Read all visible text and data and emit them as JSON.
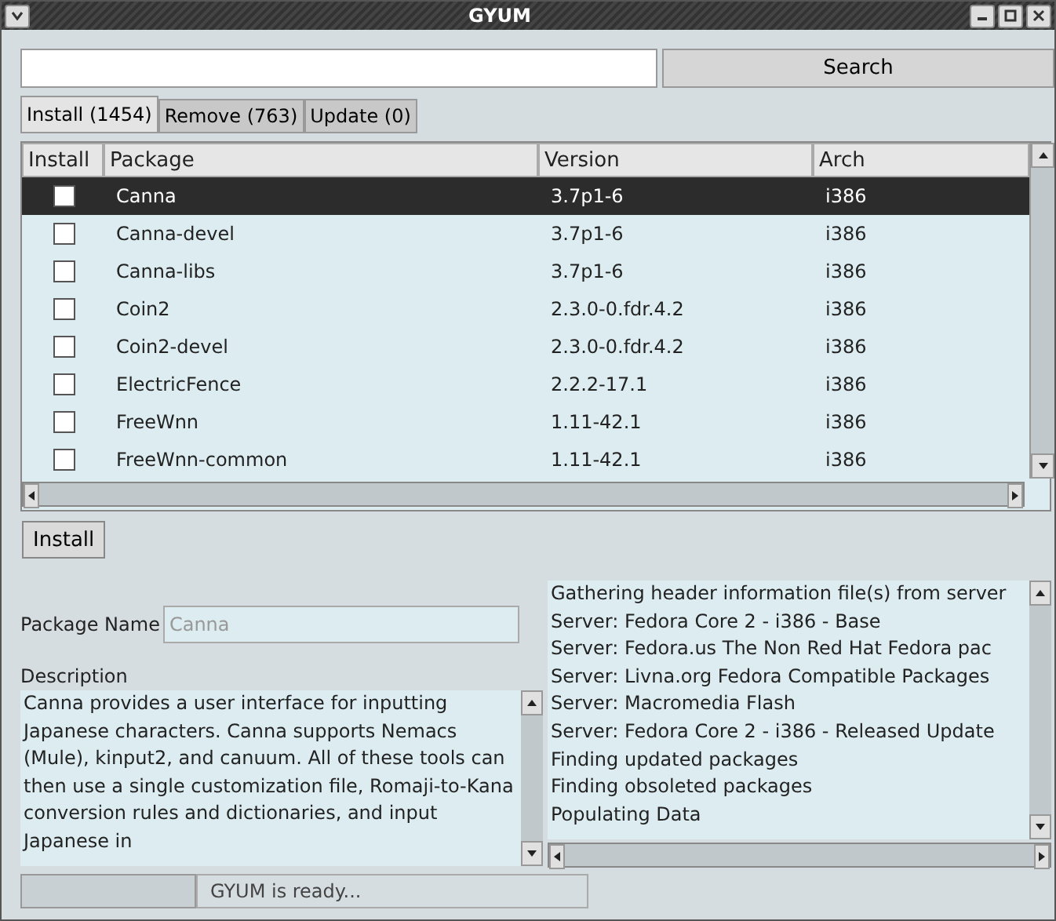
{
  "window": {
    "title": "GYUM"
  },
  "search": {
    "button": "Search"
  },
  "tabs": [
    {
      "label": "Install (1454)",
      "selected": true
    },
    {
      "label": "Remove (763)",
      "selected": false
    },
    {
      "label": "Update (0)",
      "selected": false
    }
  ],
  "table": {
    "columns": [
      "Install",
      "Package",
      "Version",
      "Arch"
    ],
    "rows": [
      {
        "checked": false,
        "selected": true,
        "package": "Canna",
        "version": "3.7p1-6",
        "arch": "i386"
      },
      {
        "checked": false,
        "selected": false,
        "package": "Canna-devel",
        "version": "3.7p1-6",
        "arch": "i386"
      },
      {
        "checked": false,
        "selected": false,
        "package": "Canna-libs",
        "version": "3.7p1-6",
        "arch": "i386"
      },
      {
        "checked": false,
        "selected": false,
        "package": "Coin2",
        "version": "2.3.0-0.fdr.4.2",
        "arch": "i386"
      },
      {
        "checked": false,
        "selected": false,
        "package": "Coin2-devel",
        "version": "2.3.0-0.fdr.4.2",
        "arch": "i386"
      },
      {
        "checked": false,
        "selected": false,
        "package": "ElectricFence",
        "version": "2.2.2-17.1",
        "arch": "i386"
      },
      {
        "checked": false,
        "selected": false,
        "package": "FreeWnn",
        "version": "1.11-42.1",
        "arch": "i386"
      },
      {
        "checked": false,
        "selected": false,
        "package": "FreeWnn-common",
        "version": "1.11-42.1",
        "arch": "i386"
      }
    ]
  },
  "action_button": "Install",
  "details": {
    "package_name_label": "Package Name",
    "package_name": "Canna",
    "description_label": "Description",
    "description": "Canna provides a user interface for inputting Japanese characters. Canna supports Nemacs (Mule), kinput2, and canuum. All of these tools can then use a single customization file, Romaji-to-Kana conversion rules and dictionaries, and input Japanese in"
  },
  "log": [
    "Gathering header information file(s) from server",
    "Server: Fedora Core 2 - i386 - Base",
    "Server: Fedora.us The Non Red Hat Fedora pac",
    "Server: Livna.org Fedora Compatible Packages",
    "Server: Macromedia Flash",
    "Server: Fedora Core 2 - i386 - Released Update",
    "Finding updated packages",
    "Finding obsoleted packages",
    "Populating Data"
  ],
  "progress": {
    "level": 0
  },
  "status_bar": "GYUM is ready..."
}
